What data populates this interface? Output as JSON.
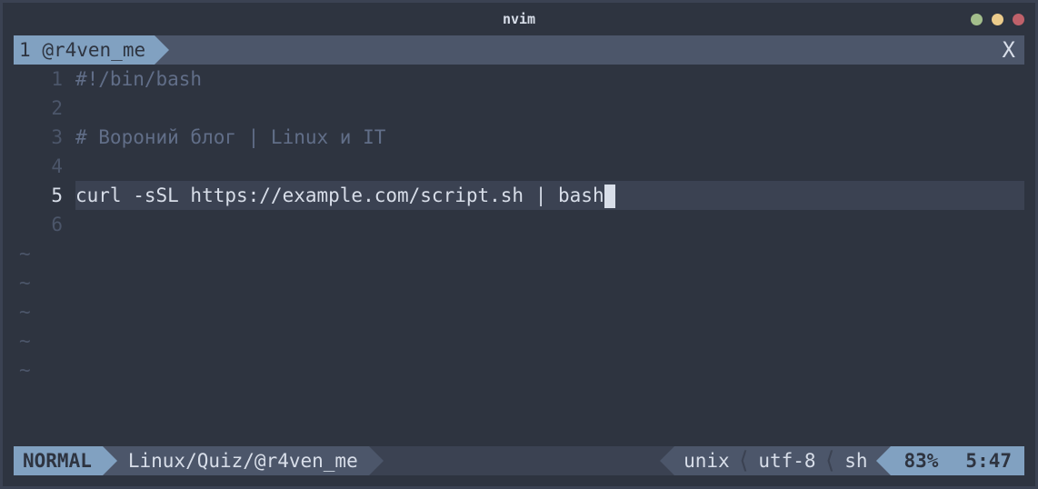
{
  "window": {
    "title": "nvim"
  },
  "tabline": {
    "tab_number": "1",
    "tab_label": "@r4ven_me",
    "close_glyph": "X"
  },
  "lines": [
    {
      "num": "1",
      "text": "#!/bin/bash",
      "cls": "comment"
    },
    {
      "num": "2",
      "text": "",
      "cls": ""
    },
    {
      "num": "3",
      "text": "# Вороний блог | Linux и IT",
      "cls": "comment"
    },
    {
      "num": "4",
      "text": "",
      "cls": ""
    },
    {
      "num": "5",
      "text": "curl -sSL https://example.com/script.sh | bash",
      "cls": "",
      "current": true
    },
    {
      "num": "6",
      "text": "",
      "cls": ""
    }
  ],
  "tilde": "~",
  "status": {
    "mode": "NORMAL",
    "path": "Linux/Quiz/@r4ven_me",
    "fileformat": "unix",
    "encoding": "utf-8",
    "filetype": "sh",
    "percent": "83%",
    "position": "5:47"
  }
}
